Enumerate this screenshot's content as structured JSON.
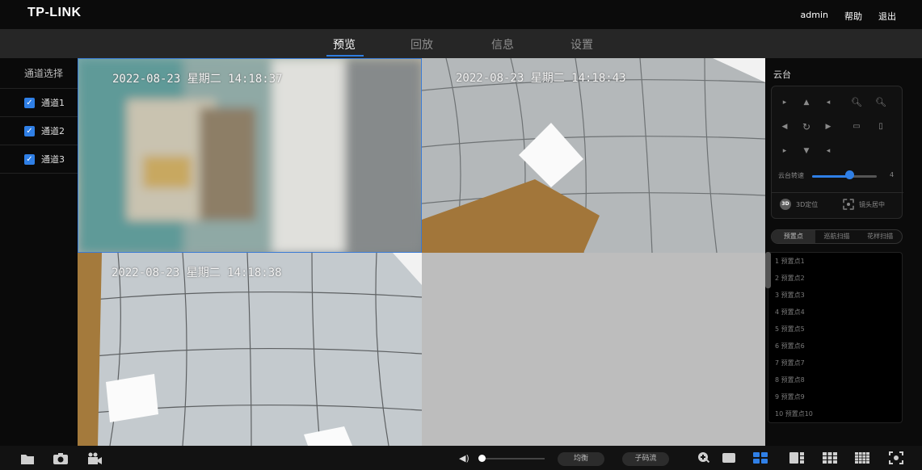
{
  "app": {
    "logo": "TP-LINK"
  },
  "header": {
    "user": "admin",
    "help": "帮助",
    "logout": "退出"
  },
  "nav": {
    "tabs": [
      {
        "label": "预览",
        "active": true
      },
      {
        "label": "回放"
      },
      {
        "label": "信息"
      },
      {
        "label": "设置"
      }
    ]
  },
  "sidebar": {
    "title": "通道选择",
    "channels": [
      {
        "label": "通道1",
        "checked": true
      },
      {
        "label": "通道2",
        "checked": true
      },
      {
        "label": "通道3",
        "checked": true
      }
    ]
  },
  "video": {
    "panes": [
      {
        "osd": "2022-08-23 星期二 14:18:37"
      },
      {
        "osd": "2022-08-23 星期二 14:18:43"
      },
      {
        "osd": "2022-08-23 星期二 14:18:38"
      },
      {
        "osd": ""
      }
    ]
  },
  "ptz": {
    "title": "云台",
    "speed_label": "云台转速",
    "speed_value": "4",
    "speed_max": 7,
    "btn_3d": "3D定位",
    "btn_3d_icon_text": "3D",
    "btn_center": "镜头居中",
    "preset_tabs": [
      {
        "label": "预置点",
        "active": true
      },
      {
        "label": "巡航扫描"
      },
      {
        "label": "花样扫描"
      }
    ],
    "presets": [
      "1 预置点1",
      "2 预置点2",
      "3 预置点3",
      "4 预置点4",
      "5 预置点5",
      "6 预置点6",
      "7 预置点7",
      "8 预置点8",
      "9 预置点9",
      "10 预置点10"
    ]
  },
  "bottom": {
    "balance_label": "均衡",
    "substream_label": "子码流",
    "volume_level": 0
  },
  "colors": {
    "accent": "#2f7fe6",
    "topbar": "#0b0b0b",
    "navbar": "#262626"
  }
}
